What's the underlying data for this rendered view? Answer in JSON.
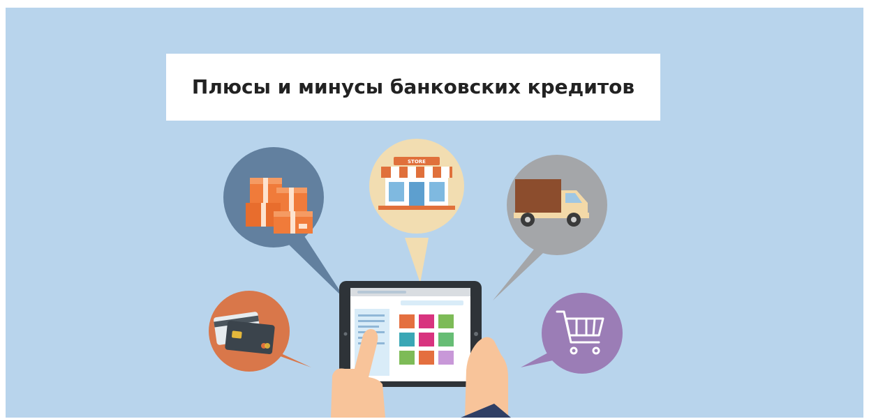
{
  "title": "Плюсы и минусы банковских кредитов",
  "store_sign": "STORE",
  "colors": {
    "background": "#b8d4ec",
    "boxes_bubble": "#62809f",
    "store_bubble": "#f2ddb1",
    "truck_bubble": "#a4a6a9",
    "card_bubble": "#d9774a",
    "cart_bubble": "#9b7db6",
    "tablet": "#2e3338"
  },
  "icons": {
    "boxes": "boxes-icon",
    "store": "store-icon",
    "truck": "truck-icon",
    "card": "credit-card-icon",
    "cart": "shopping-cart-icon",
    "tablet": "tablet-icon"
  }
}
